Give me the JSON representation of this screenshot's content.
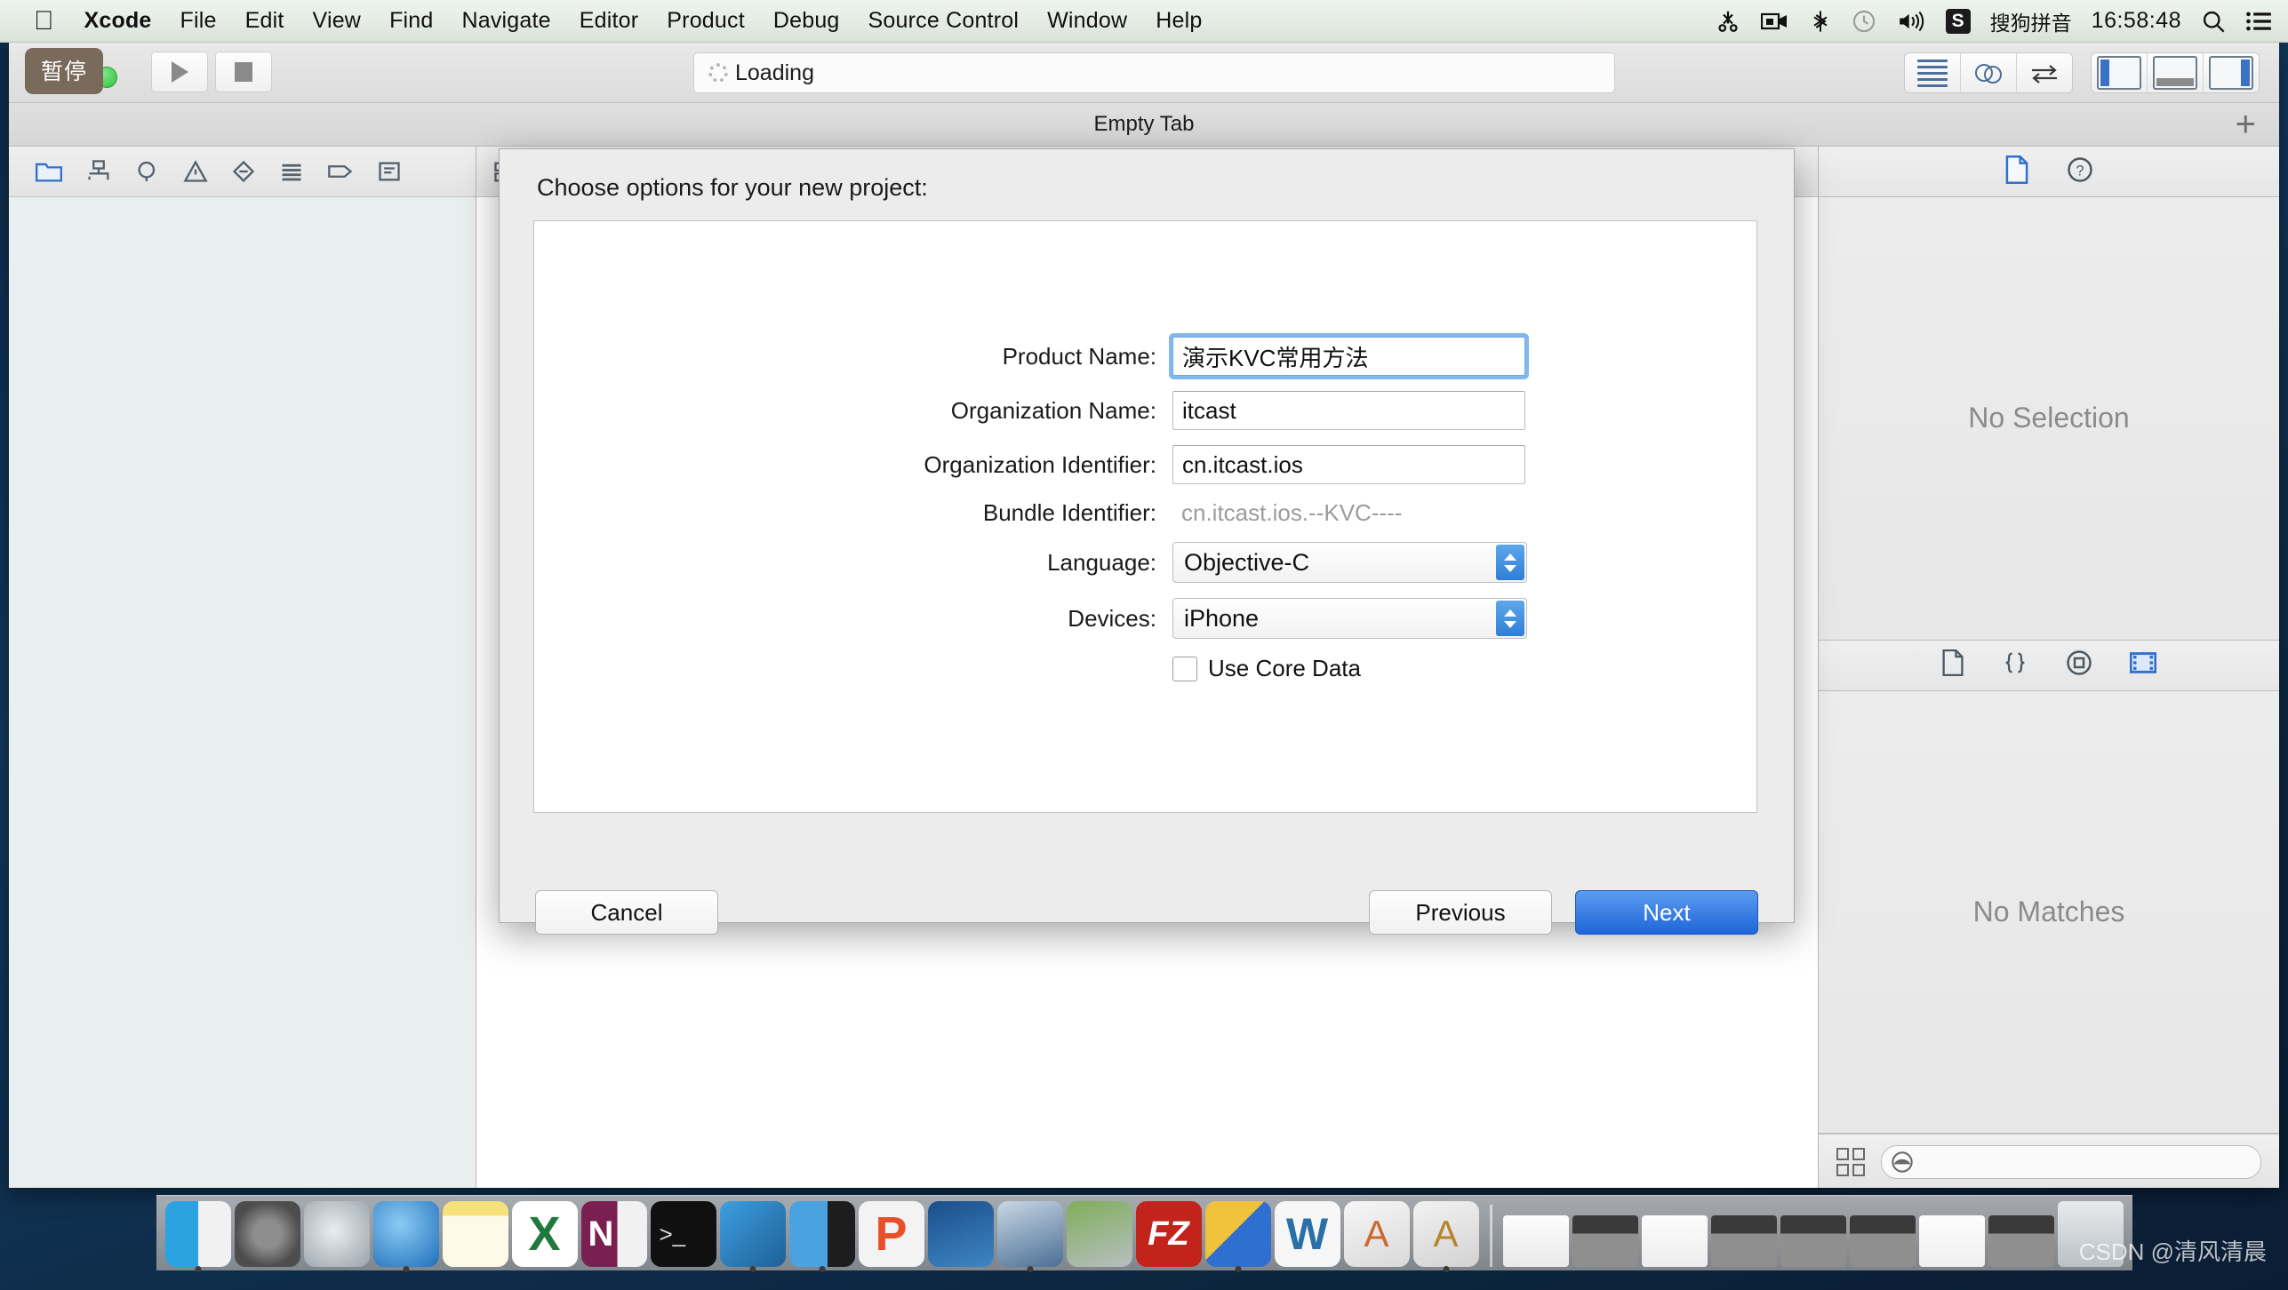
{
  "menubar": {
    "apple_icon": "apple-logo-icon",
    "items": [
      {
        "label": "Xcode",
        "bold": true
      },
      {
        "label": "File",
        "bold": false
      },
      {
        "label": "Edit",
        "bold": false
      },
      {
        "label": "View",
        "bold": false
      },
      {
        "label": "Find",
        "bold": false
      },
      {
        "label": "Navigate",
        "bold": false
      },
      {
        "label": "Editor",
        "bold": false
      },
      {
        "label": "Product",
        "bold": false
      },
      {
        "label": "Debug",
        "bold": false
      },
      {
        "label": "Source Control",
        "bold": false
      },
      {
        "label": "Window",
        "bold": false
      },
      {
        "label": "Help",
        "bold": false
      }
    ],
    "tray": {
      "icons": [
        "scissors-icon",
        "video-camera-icon",
        "bluetooth-icon",
        "clock-icon",
        "volume-icon"
      ],
      "ime_badge": "S",
      "ime_label": "搜狗拼音",
      "clock": "16:58:48",
      "search_icon": "search-icon",
      "list_icon": "notification-center-icon"
    }
  },
  "toolbar": {
    "pause_tooltip": "暂停",
    "run_icon": "play-icon",
    "stop_icon": "stop-icon",
    "status": {
      "spinner_icon": "loading-spinner-icon",
      "text": "Loading"
    },
    "editor_segments": [
      "standard-editor-icon",
      "assistant-editor-icon",
      "version-editor-icon"
    ],
    "view_toggles": [
      "navigator-toggle-icon",
      "debug-area-toggle-icon",
      "utilities-toggle-icon"
    ]
  },
  "tabbar": {
    "tab_label": "Empty Tab",
    "add_tab_label": "+"
  },
  "navigator": {
    "icons": [
      "folder-project-navigator-icon",
      "symbol-navigator-icon",
      "search-navigator-icon",
      "issue-navigator-icon",
      "test-navigator-icon",
      "debug-navigator-icon",
      "breakpoint-navigator-icon",
      "report-navigator-icon"
    ],
    "selected_index": 0
  },
  "utilities": {
    "inspector_tabs": [
      "file-inspector-icon",
      "quick-help-inspector-icon"
    ],
    "inspector_selected_index": 0,
    "inspector_empty_text": "No Selection",
    "library_tabs": [
      "file-template-library-icon",
      "code-snippet-library-icon",
      "object-library-icon",
      "media-library-icon"
    ],
    "library_selected_index": 3,
    "library_empty_text": "No Matches",
    "library_filter_placeholder": "",
    "grid_icon": "grid-view-icon",
    "filter_icon": "filter-search-icon"
  },
  "sheet": {
    "title": "Choose options for your new project:",
    "fields": [
      {
        "label": "Product Name:",
        "value": "演示KVC常用方法",
        "type": "text",
        "focused": true,
        "name": "product-name"
      },
      {
        "label": "Organization Name:",
        "value": "itcast",
        "type": "text",
        "focused": false,
        "name": "organization-name"
      },
      {
        "label": "Organization Identifier:",
        "value": "cn.itcast.ios",
        "type": "text",
        "focused": false,
        "name": "organization-identifier"
      },
      {
        "label": "Bundle Identifier:",
        "value": "cn.itcast.ios.--KVC----",
        "type": "static",
        "focused": false,
        "name": "bundle-identifier"
      },
      {
        "label": "Language:",
        "value": "Objective-C",
        "type": "popup",
        "focused": false,
        "name": "language"
      },
      {
        "label": "Devices:",
        "value": "iPhone",
        "type": "popup",
        "focused": false,
        "name": "devices"
      }
    ],
    "checkbox": {
      "label": "Use Core Data",
      "checked": false
    },
    "buttons": {
      "cancel": "Cancel",
      "previous": "Previous",
      "next": "Next"
    },
    "accent_color": "#2f7fd6"
  },
  "dock": {
    "left_items": [
      {
        "name": "finder",
        "color1": "#2aa3e0",
        "color2": "#f5f5f5"
      },
      {
        "name": "system-preferences",
        "color1": "#8d8d8d",
        "color2": "#4d4d4d"
      },
      {
        "name": "launchpad",
        "color1": "#d9dde0",
        "color2": "#9aa3a9"
      },
      {
        "name": "safari",
        "color1": "#57b2ef",
        "color2": "#1e6fb8"
      },
      {
        "name": "stickies",
        "color1": "#f6e27a",
        "color2": "#fdfbe8"
      },
      {
        "name": "microsoft-excel",
        "color1": "#1e7a3c",
        "color2": "#3aa95c"
      },
      {
        "name": "microsoft-onenote",
        "color1": "#7a2050",
        "color2": "#f1f1f1"
      },
      {
        "name": "terminal",
        "color1": "#101010",
        "color2": "#303030"
      },
      {
        "name": "xcode",
        "color1": "#2d8fd6",
        "color2": "#1f5f96"
      },
      {
        "name": "simulator",
        "color1": "#4aa3e0",
        "color2": "#1d1d1d"
      },
      {
        "name": "pp-assistant",
        "color1": "#e8502a",
        "color2": "#f07a4a"
      },
      {
        "name": "snip-tool",
        "color1": "#1a4f8a",
        "color2": "#6fb6e8"
      },
      {
        "name": "quicktime-player",
        "color1": "#4a6f95",
        "color2": "#c9d7e4"
      },
      {
        "name": "archive-utility",
        "color1": "#5d8f3e",
        "color2": "#c0c6c9"
      },
      {
        "name": "filezilla",
        "color1": "#c2241b",
        "color2": "#ffffff"
      },
      {
        "name": "paint-design",
        "color1": "#f0c23a",
        "color2": "#2f6fd0"
      },
      {
        "name": "microsoft-word",
        "color1": "#2b6fa8",
        "color2": "#4f97cf"
      },
      {
        "name": "preview",
        "color1": "#f2f2f2",
        "color2": "#c96a2e"
      },
      {
        "name": "image-viewer",
        "color1": "#eeeeee",
        "color2": "#b5852f"
      }
    ],
    "minimized_windows": [
      {
        "name": "minimized-window-safari"
      },
      {
        "name": "minimized-window-xcode-1"
      },
      {
        "name": "minimized-window-finder"
      },
      {
        "name": "minimized-window-xcode-2"
      },
      {
        "name": "minimized-window-xcode-3"
      },
      {
        "name": "minimized-window-xcode-4"
      },
      {
        "name": "minimized-window-document"
      },
      {
        "name": "minimized-window-xcode-5"
      }
    ],
    "trash": {
      "name": "trash-icon"
    }
  },
  "watermark": "CSDN @清风清晨"
}
